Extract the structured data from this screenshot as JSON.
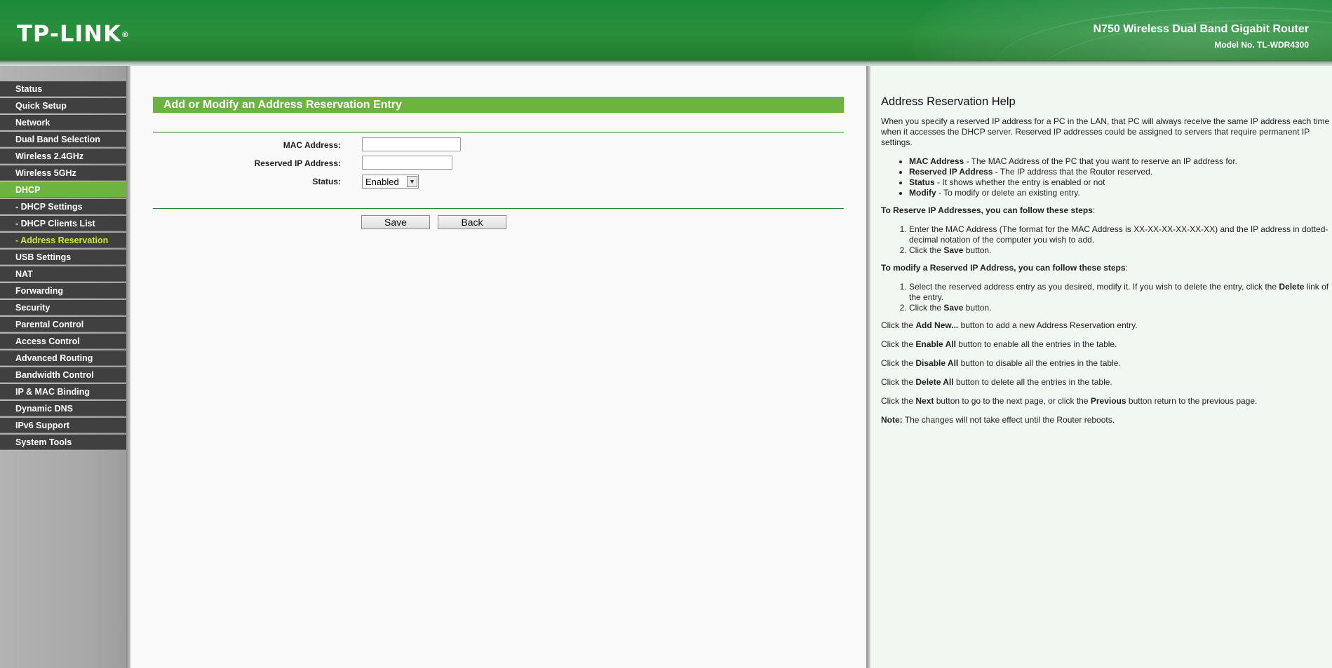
{
  "header": {
    "logo_text": "TP-LINK",
    "logo_mark": "®",
    "product_name": "N750 Wireless Dual Band Gigabit Router",
    "model_number": "Model No. TL-WDR4300"
  },
  "sidebar": {
    "items": [
      {
        "label": "Status"
      },
      {
        "label": "Quick Setup"
      },
      {
        "label": "Network"
      },
      {
        "label": "Dual Band Selection"
      },
      {
        "label": "Wireless 2.4GHz"
      },
      {
        "label": "Wireless 5GHz"
      },
      {
        "label": "DHCP"
      },
      {
        "label": "- DHCP Settings"
      },
      {
        "label": "- DHCP Clients List"
      },
      {
        "label": "- Address Reservation"
      },
      {
        "label": "USB Settings"
      },
      {
        "label": "NAT"
      },
      {
        "label": "Forwarding"
      },
      {
        "label": "Security"
      },
      {
        "label": "Parental Control"
      },
      {
        "label": "Access Control"
      },
      {
        "label": "Advanced Routing"
      },
      {
        "label": "Bandwidth Control"
      },
      {
        "label": "IP & MAC Binding"
      },
      {
        "label": "Dynamic DNS"
      },
      {
        "label": "IPv6 Support"
      },
      {
        "label": "System Tools"
      }
    ]
  },
  "form": {
    "title": "Add or Modify an Address Reservation Entry",
    "mac_label": "MAC Address:",
    "mac_value": "",
    "ip_label": "Reserved IP Address:",
    "ip_value": "",
    "status_label": "Status:",
    "status_value": "Enabled",
    "save_label": "Save",
    "back_label": "Back"
  },
  "help": {
    "title": "Address Reservation Help",
    "intro": "When you specify a reserved IP address for a PC in the LAN, that PC will always receive the same IP address each time when it accesses the DHCP server. Reserved IP addresses could be assigned to servers that require permanent IP settings.",
    "fields": [
      {
        "term": "MAC Address",
        "desc": " - The MAC Address of the PC that you want to reserve an IP address for."
      },
      {
        "term": "Reserved IP Address",
        "desc": " - The IP address that the Router reserved."
      },
      {
        "term": "Status",
        "desc": " - It shows whether the entry is enabled or not"
      },
      {
        "term": "Modify",
        "desc": " - To modify or delete an existing entry."
      }
    ],
    "reserve_heading": "To Reserve IP Addresses, you can follow these steps",
    "reserve_step1": "Enter the MAC Address (The format for the MAC Address is XX-XX-XX-XX-XX-XX) and the IP address in dotted-decimal notation of the computer you wish to add.",
    "reserve_step2_pre": "Click the ",
    "reserve_step2_bold": "Save",
    "reserve_step2_post": " button.",
    "modify_heading": "To modify a Reserved IP Address, you can follow these steps",
    "modify_step1_pre": "Select the reserved address entry as you desired, modify it. If you wish to delete the entry, click the ",
    "modify_step1_bold": "Delete",
    "modify_step1_post": " link of the entry.",
    "modify_step2_pre": "Click the ",
    "modify_step2_bold": "Save",
    "modify_step2_post": " button.",
    "lines": [
      {
        "pre": "Click the ",
        "bold": "Add New...",
        "post": " button to add a new Address Reservation entry."
      },
      {
        "pre": "Click the ",
        "bold": "Enable All",
        "post": " button to enable all the entries in the table."
      },
      {
        "pre": "Click the ",
        "bold": "Disable All",
        "post": " button to disable all the entries in the table."
      },
      {
        "pre": "Click the ",
        "bold": "Delete All",
        "post": " button to delete all the entries in the table."
      }
    ],
    "next_pre": "Click the ",
    "next_bold": "Next",
    "next_mid": " button to go to the next page, or click the ",
    "next_bold2": "Previous",
    "next_post": " button return to the previous page.",
    "note_bold": "Note:",
    "note_text": " The changes will not take effect until the Router reboots."
  },
  "colors": {
    "brand_green": "#2a8f3b",
    "accent_green": "#6cb33f",
    "nav_dark": "#404040",
    "nav_current_text": "#c8ec3b"
  }
}
